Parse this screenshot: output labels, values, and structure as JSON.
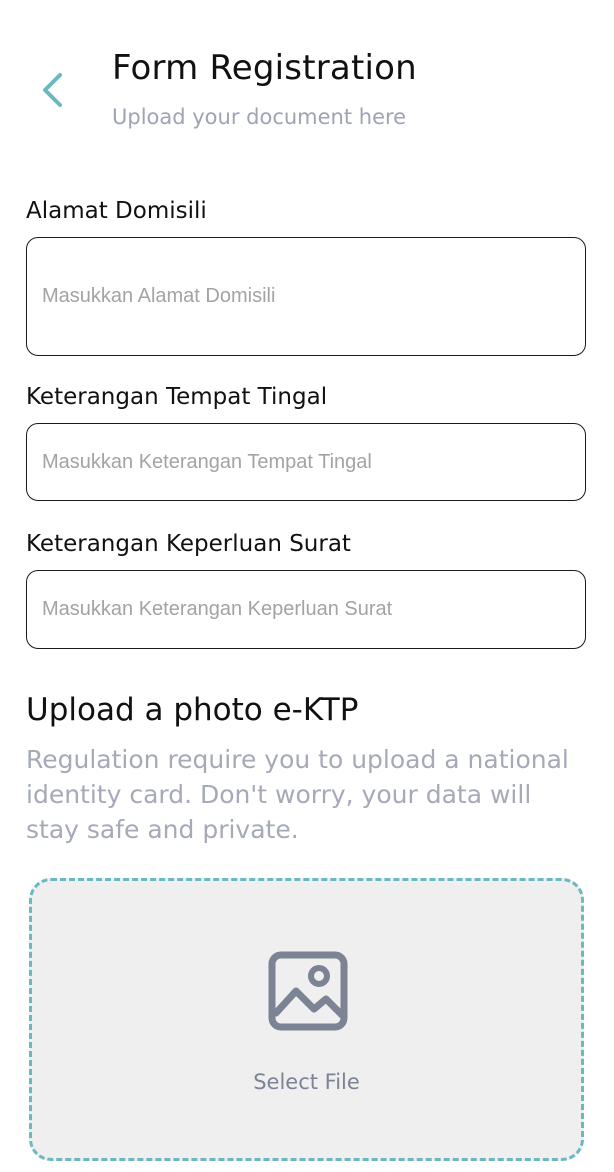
{
  "header": {
    "title": "Form Registration",
    "subtitle": "Upload your document here",
    "back_icon": "chevron-left-icon",
    "accent_color": "#6cb8c1"
  },
  "form": {
    "alamat": {
      "label": "Alamat Domisili",
      "placeholder": "Masukkan Alamat Domisili",
      "value": ""
    },
    "tempat_tinggal": {
      "label": "Keterangan Tempat Tingal",
      "placeholder": "Masukkan Keterangan Tempat Tingal",
      "value": ""
    },
    "keperluan": {
      "label": "Keterangan Keperluan Surat",
      "placeholder": "Masukkan Keterangan Keperluan Surat",
      "value": ""
    }
  },
  "upload": {
    "heading": "Upload a photo e-KTP",
    "description": "Regulation require you to upload a national identity card. Don't worry, your data will stay safe and private.",
    "select_label": "Select File",
    "icon": "image-icon",
    "border_color": "#6cb8c1",
    "background": "#efefef"
  }
}
